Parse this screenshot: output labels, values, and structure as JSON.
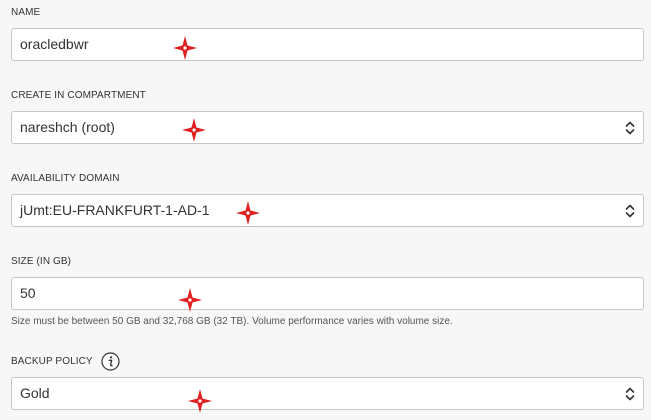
{
  "fields": {
    "name": {
      "label": "NAME",
      "value": "oracledbwr"
    },
    "compartment": {
      "label": "CREATE IN COMPARTMENT",
      "value": "nareshch (root)"
    },
    "availability_domain": {
      "label": "AVAILABILITY DOMAIN",
      "value": "jUmt:EU-FRANKFURT-1-AD-1"
    },
    "size": {
      "label": "SIZE (IN GB)",
      "value": "50",
      "hint": "Size must be between 50 GB and 32,768 GB (32 TB). Volume performance varies with volume size."
    },
    "backup_policy": {
      "label": "BACKUP POLICY",
      "value": "Gold"
    }
  },
  "icons": {
    "info": "info-icon",
    "select_arrows": "chevron-updown-icon",
    "marker": "red-star-marker-icon"
  },
  "colors": {
    "marker": "#e02020",
    "border": "#c6c6c6",
    "background": "#f7f7f7"
  }
}
